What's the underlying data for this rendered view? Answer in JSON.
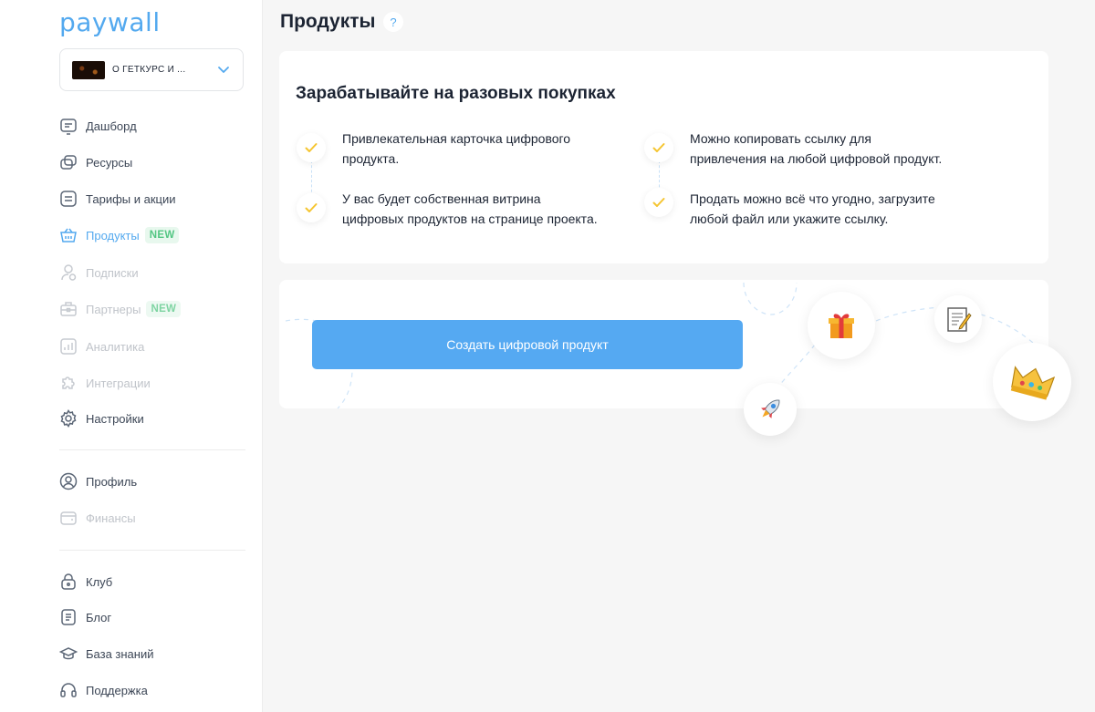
{
  "app": {
    "logo": "paywall"
  },
  "project_selector": {
    "name": "О ГЕТКУРС И ..."
  },
  "nav": {
    "main": [
      {
        "label": "Дашборд",
        "icon": "dashboard-icon"
      },
      {
        "label": "Ресурсы",
        "icon": "resources-icon"
      },
      {
        "label": "Тарифы и акции",
        "icon": "tariffs-icon"
      },
      {
        "label": "Продукты",
        "icon": "basket-icon",
        "badge": "NEW",
        "active": true
      },
      {
        "label": "Подписки",
        "icon": "subscriptions-icon",
        "disabled": true
      },
      {
        "label": "Партнеры",
        "icon": "partners-icon",
        "badge": "NEW",
        "disabled": true
      },
      {
        "label": "Аналитика",
        "icon": "analytics-icon",
        "disabled": true
      },
      {
        "label": "Интеграции",
        "icon": "puzzle-icon",
        "disabled": true
      },
      {
        "label": "Настройки",
        "icon": "gear-icon"
      }
    ],
    "account": [
      {
        "label": "Профиль",
        "icon": "profile-icon"
      },
      {
        "label": "Финансы",
        "icon": "wallet-icon",
        "disabled": true
      }
    ],
    "help": [
      {
        "label": "Клуб",
        "icon": "lock-icon"
      },
      {
        "label": "Блог",
        "icon": "blog-icon"
      },
      {
        "label": "База знаний",
        "icon": "graduation-cap-icon"
      },
      {
        "label": "Поддержка",
        "icon": "headset-icon"
      }
    ]
  },
  "page": {
    "title": "Продукты",
    "help": "?"
  },
  "intro": {
    "heading": "Зарабатывайте на разовых покупках",
    "features": [
      {
        "line1": "Привлекательная карточка цифрового",
        "line2": "продукта."
      },
      {
        "line1": "Можно копировать ссылку для",
        "line2": "привлечения на любой цифровой продукт."
      },
      {
        "line1": "У вас будет собственная витрина",
        "line2": "цифровых продуктов на странице проекта."
      },
      {
        "line1": "Продать можно всё что угодно, загрузите",
        "line2": "любой файл или укажите ссылку."
      }
    ]
  },
  "cta": {
    "label": "Создать цифровой продукт"
  },
  "colors": {
    "accent": "#53a9ef",
    "button": "#55a9f2",
    "badge_bg": "#e8f8ee",
    "badge_text": "#54c683",
    "check": "#f5c531"
  }
}
